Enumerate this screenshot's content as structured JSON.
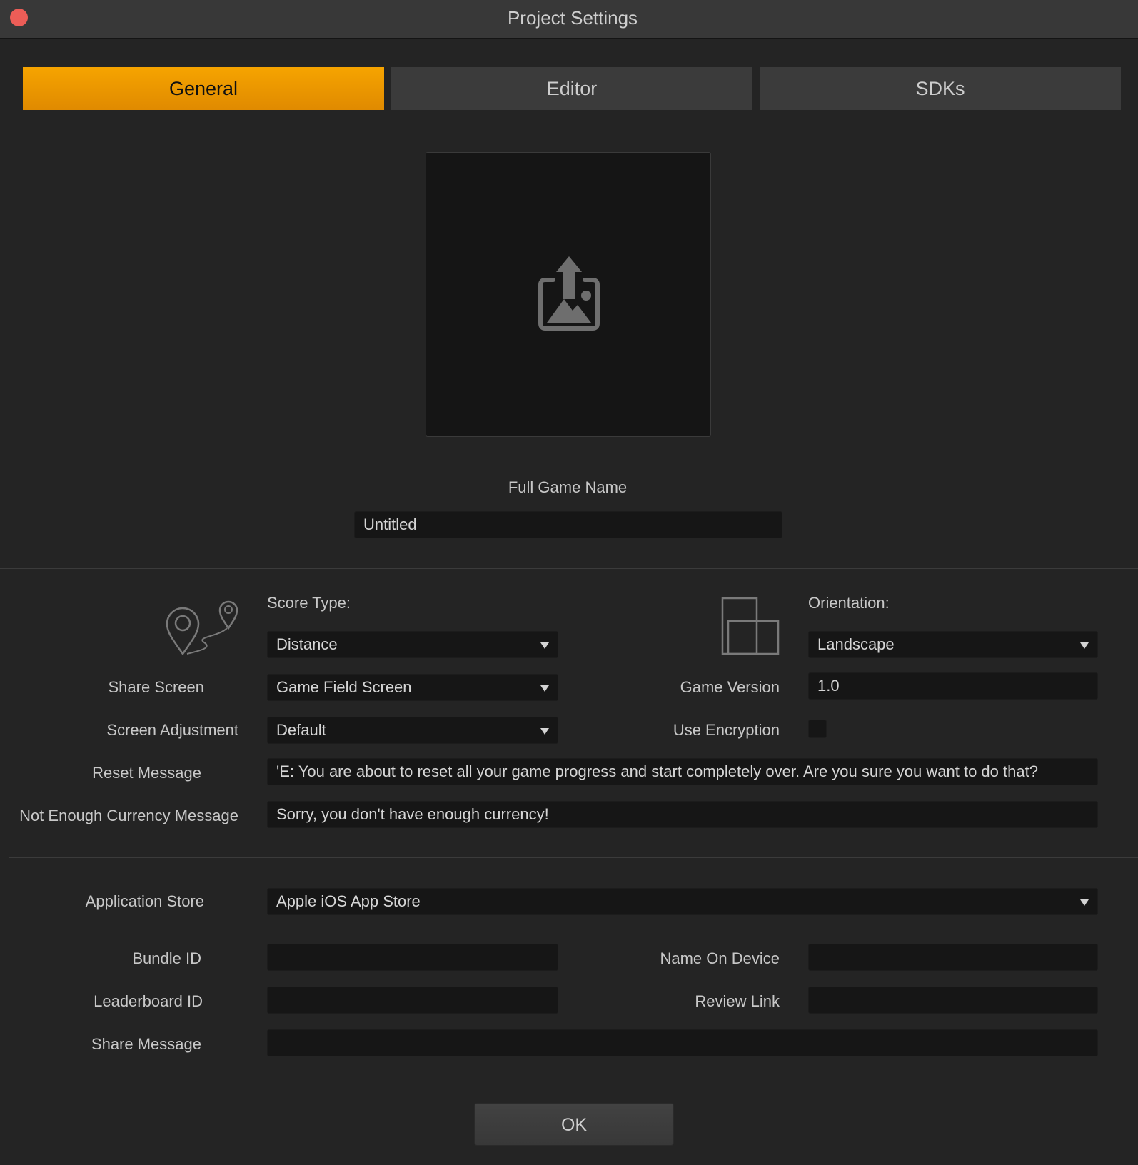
{
  "window": {
    "title": "Project Settings"
  },
  "tabs": [
    {
      "label": "General",
      "active": true
    },
    {
      "label": "Editor",
      "active": false
    },
    {
      "label": "SDKs",
      "active": false
    }
  ],
  "icon_upload": "image-upload-icon",
  "game_name": {
    "label": "Full Game Name",
    "value": "Untitled"
  },
  "score_type": {
    "label": "Score Type:",
    "value": "Distance",
    "icon": "map-pin-route-icon"
  },
  "orientation": {
    "label": "Orientation:",
    "value": "Landscape",
    "icon": "orientation-icon"
  },
  "share_screen": {
    "label": "Share Screen",
    "value": "Game Field Screen"
  },
  "game_version": {
    "label": "Game Version",
    "value": "1.0"
  },
  "screen_adjustment": {
    "label": "Screen Adjustment",
    "value": "Default"
  },
  "use_encryption": {
    "label": "Use Encryption",
    "checked": false
  },
  "reset_message": {
    "label": "Reset Message",
    "value": "'E:  You are about to reset all your game progress and start completely over.  Are you sure you want to do that?"
  },
  "currency_message": {
    "label": "Not Enough Currency Message",
    "value": "Sorry, you don't have enough currency!"
  },
  "app_store": {
    "label": "Application Store",
    "value": "Apple iOS App Store"
  },
  "bundle_id": {
    "label": "Bundle ID",
    "value": ""
  },
  "name_on_device": {
    "label": "Name On Device",
    "value": ""
  },
  "leaderboard_id": {
    "label": "Leaderboard ID",
    "value": ""
  },
  "review_link": {
    "label": "Review Link",
    "value": ""
  },
  "share_message": {
    "label": "Share Message",
    "value": ""
  },
  "ok_button": {
    "label": "OK"
  },
  "colors": {
    "accent": "#f6a400",
    "background": "#242424",
    "field": "#161616",
    "close": "#ec5d57"
  }
}
